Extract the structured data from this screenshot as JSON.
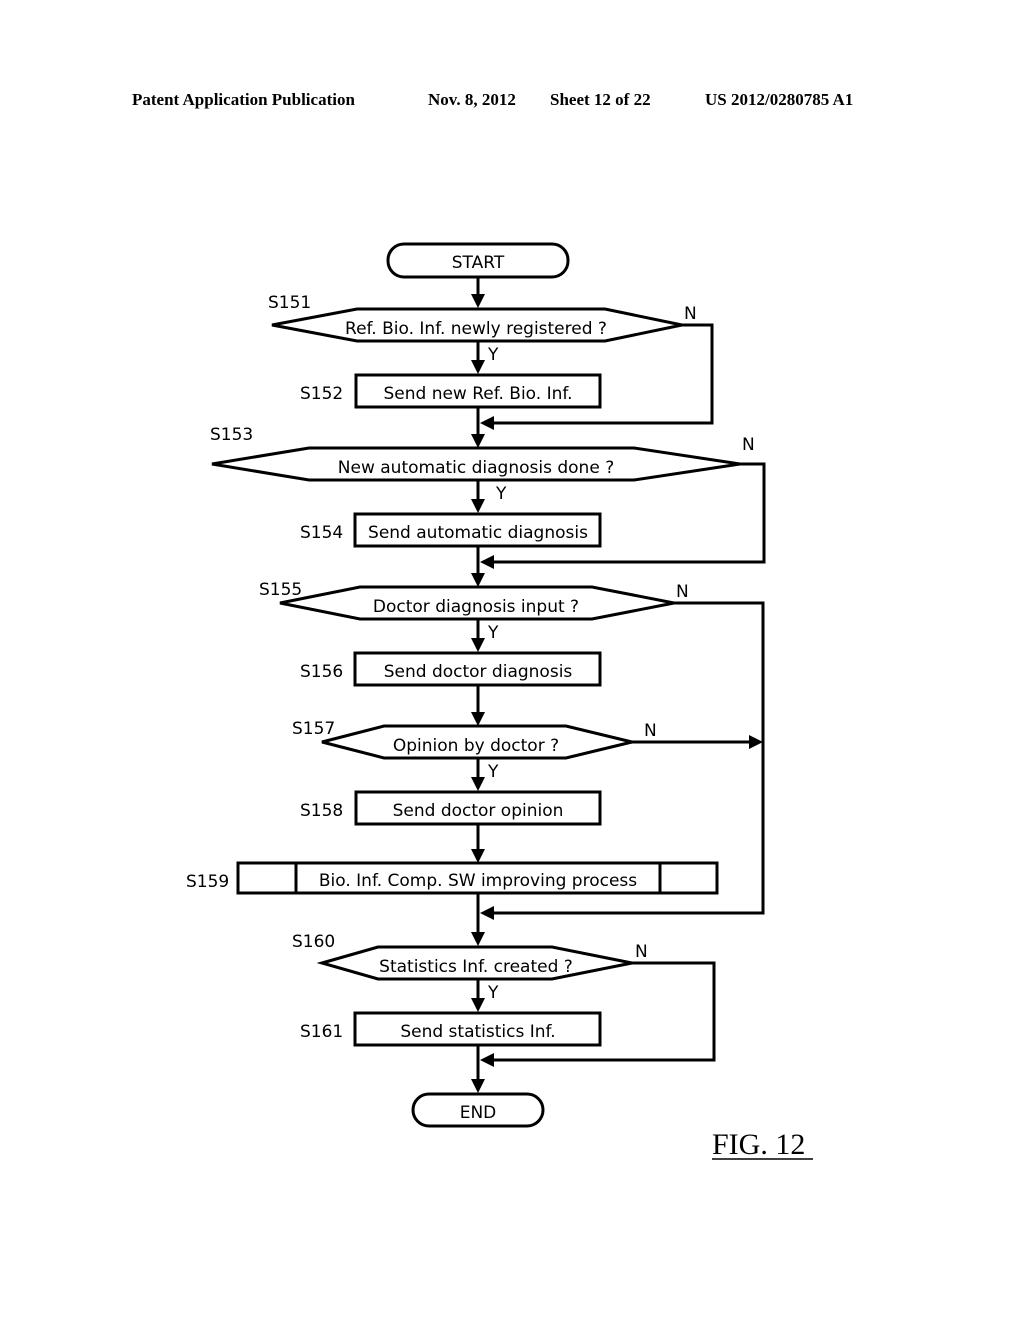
{
  "header": {
    "publication": "Patent Application Publication",
    "date": "Nov. 8, 2012",
    "sheet": "Sheet 12 of 22",
    "number": "US 2012/0280785 A1"
  },
  "figure_label": "FIG. 12",
  "flowchart": {
    "start": "START",
    "end": "END",
    "yes_label": "Y",
    "no_label": "N",
    "steps": [
      {
        "id": "S151",
        "type": "decision",
        "text": "Ref.  Bio. Inf. newly  registered ?"
      },
      {
        "id": "S152",
        "type": "process",
        "text": "Send new Ref.  Bio. Inf."
      },
      {
        "id": "S153",
        "type": "decision",
        "text": "New automatic diagnosis done ?"
      },
      {
        "id": "S154",
        "type": "process",
        "text": "Send automatic diagnosis"
      },
      {
        "id": "S155",
        "type": "decision",
        "text": "Doctor diagnosis input ?"
      },
      {
        "id": "S156",
        "type": "process",
        "text": "Send doctor diagnosis"
      },
      {
        "id": "S157",
        "type": "decision",
        "text": "Opinion by doctor ?"
      },
      {
        "id": "S158",
        "type": "process",
        "text": "Send doctor opinion"
      },
      {
        "id": "S159",
        "type": "subprocess",
        "text": "Bio. Inf. Comp. SW improving process"
      },
      {
        "id": "S160",
        "type": "decision",
        "text": "Statistics Inf. created ?"
      },
      {
        "id": "S161",
        "type": "process",
        "text": "Send statistics Inf."
      }
    ]
  }
}
